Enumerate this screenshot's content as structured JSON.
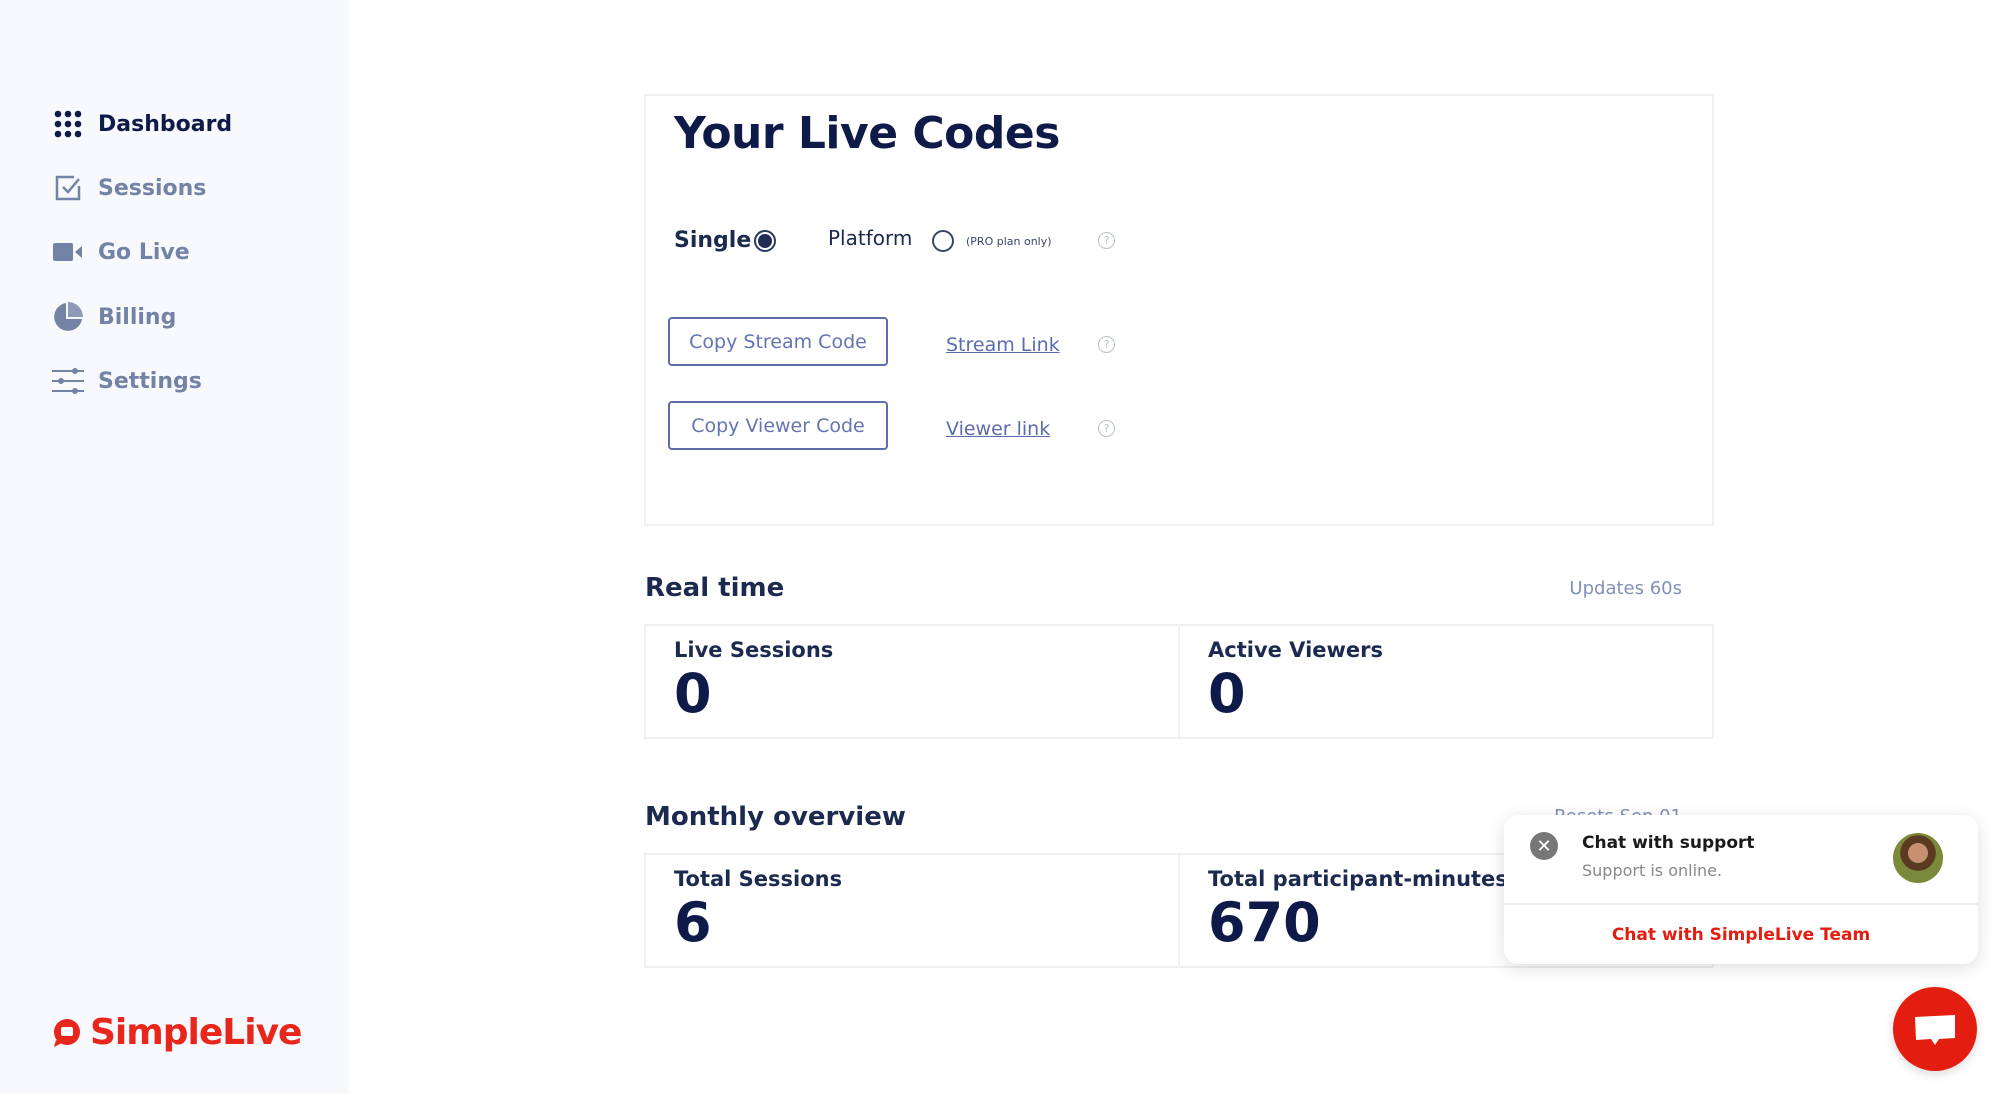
{
  "sidebar": {
    "items": [
      {
        "label": "Dashboard",
        "icon": "grid-icon",
        "active": true
      },
      {
        "label": "Sessions",
        "icon": "checkbox-icon"
      },
      {
        "label": "Go Live",
        "icon": "video-camera-icon"
      },
      {
        "label": "Billing",
        "icon": "pie-chart-icon"
      },
      {
        "label": "Settings",
        "icon": "sliders-icon"
      }
    ],
    "logo": "SimpleLive"
  },
  "live_codes": {
    "title": "Your Live Codes",
    "single_label": "Single",
    "platform_label": "Platform",
    "pro_note": "(PRO plan only)",
    "selected": "Single",
    "copy_stream": "Copy Stream Code",
    "stream_link": "Stream Link",
    "copy_viewer": "Copy Viewer Code",
    "viewer_link": "Viewer link"
  },
  "realtime": {
    "title": "Real time",
    "note": "Updates 60s",
    "stats": [
      {
        "label": "Live Sessions",
        "value": "0"
      },
      {
        "label": "Active Viewers",
        "value": "0"
      }
    ]
  },
  "monthly": {
    "title": "Monthly overview",
    "note": "Resets Sep 01",
    "stats": [
      {
        "label": "Total Sessions",
        "value": "6"
      },
      {
        "label": "Total participant-minutes",
        "value": "670"
      }
    ]
  },
  "chat": {
    "title": "Chat with support",
    "status": "Support is online.",
    "cta": "Chat with SimpleLive Team"
  },
  "colors": {
    "brand": "#e8261c",
    "navy": "#0e1a48",
    "accent": "#5d6ea8"
  }
}
